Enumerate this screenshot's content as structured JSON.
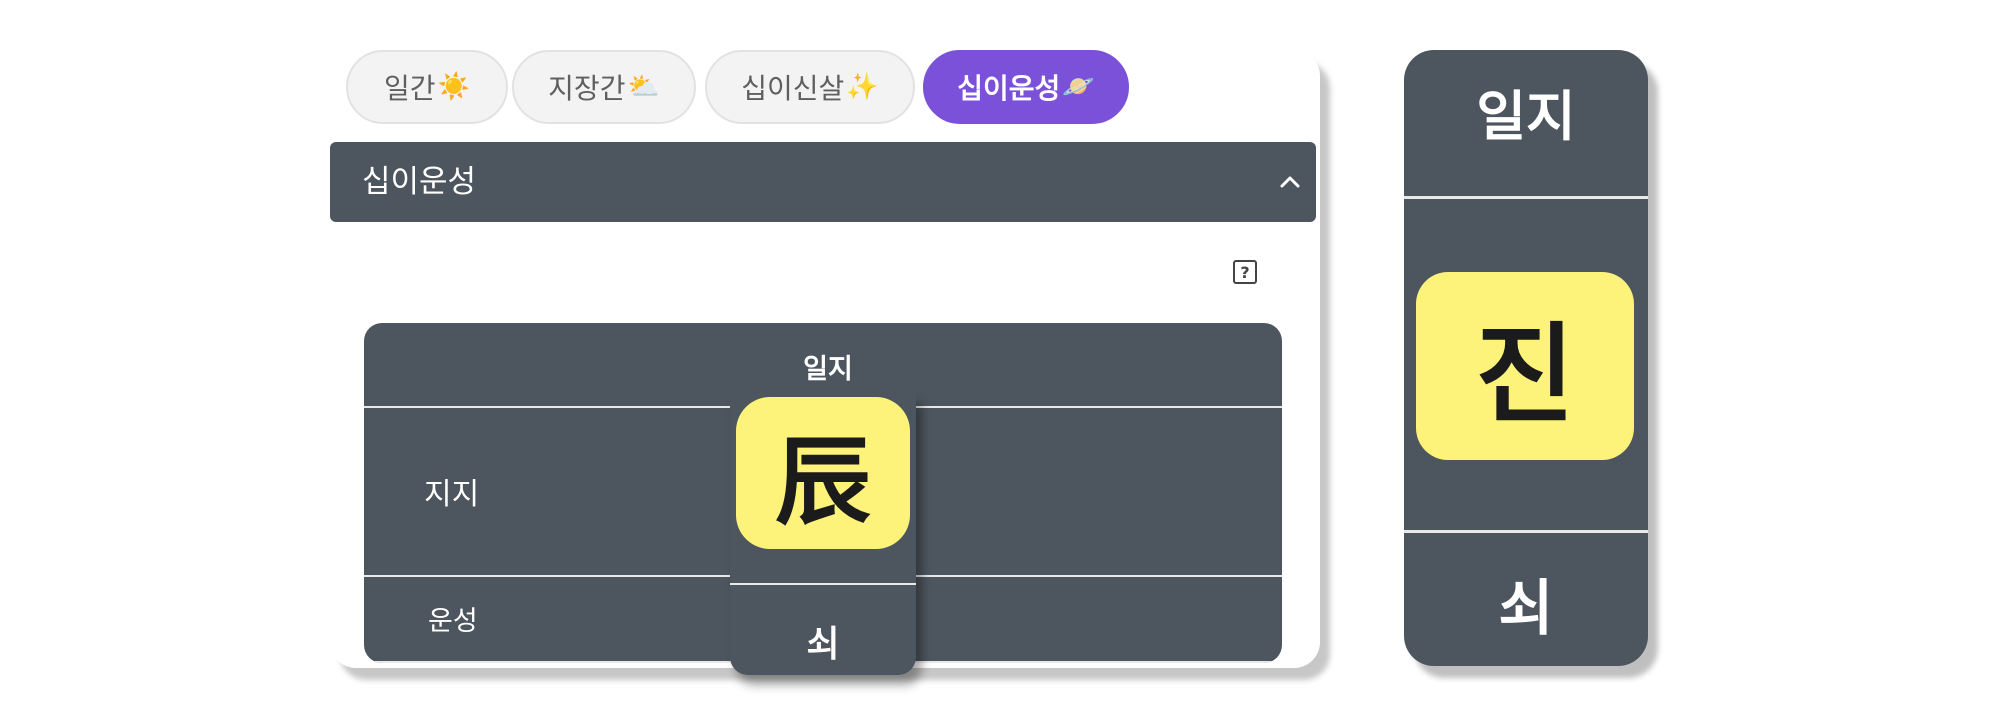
{
  "tabs": [
    {
      "label": "일간",
      "emoji": "☀️",
      "active": false
    },
    {
      "label": "지장간",
      "emoji": "⛅",
      "active": false
    },
    {
      "label": "십이신살",
      "emoji": "✨",
      "active": false
    },
    {
      "label": "십이운성",
      "emoji": "🪐",
      "active": true
    }
  ],
  "section": {
    "title": "십이운성",
    "chevron_icon": "chevron-up-icon"
  },
  "help_icon": {
    "symbol": "?"
  },
  "table": {
    "column_header": "일지",
    "row_labels": {
      "jiji": "지지",
      "unseong": "운성"
    },
    "highlight_char": "辰",
    "highlight_bottom": "쇠"
  },
  "zoom": {
    "top": "일지",
    "char": "진",
    "bottom": "쇠"
  },
  "colors": {
    "accent": "#7b51d9",
    "panel": "#4d555e",
    "highlight": "#fef37a"
  }
}
